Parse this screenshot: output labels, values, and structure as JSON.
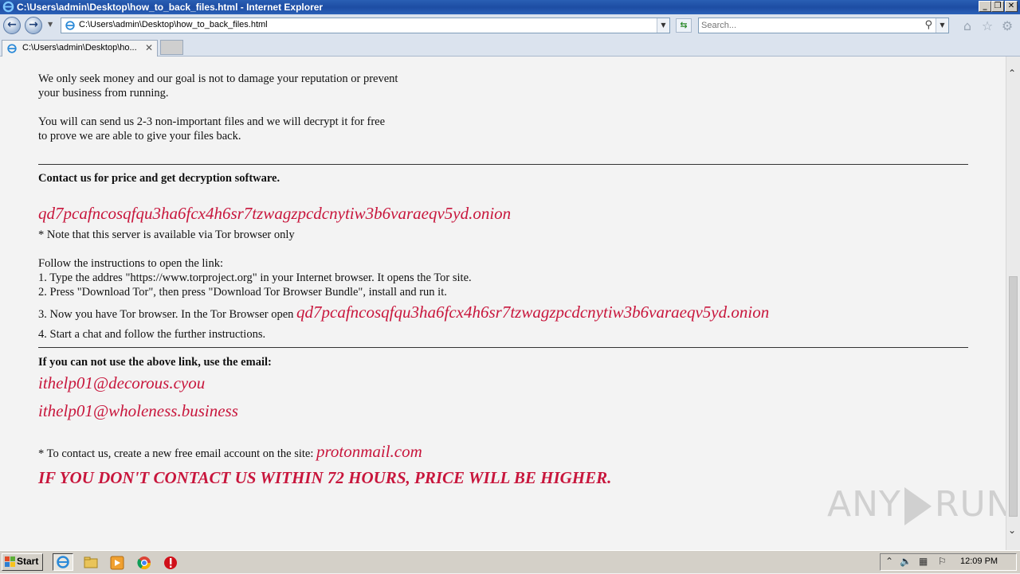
{
  "window": {
    "title": "C:\\Users\\admin\\Desktop\\how_to_back_files.html - Internet Explorer",
    "minimize_label": "_",
    "restore_label": "❐",
    "close_label": "✕"
  },
  "navbar": {
    "back_label": "←",
    "forward_label": "→",
    "address": "C:\\Users\\admin\\Desktop\\how_to_back_files.html",
    "search_placeholder": "Search...",
    "refresh_label": "⇆"
  },
  "tab": {
    "label": "C:\\Users\\admin\\Desktop\\ho...",
    "close_label": "✕"
  },
  "content": {
    "para1_line1": "We only seek money and our goal is not to damage your reputation or prevent",
    "para1_line2": "your business from running.",
    "para2_line1": "You will can send us 2-3 non-important files and we will decrypt it for free",
    "para2_line2": "to prove we are able to give your files back.",
    "contact_heading": "Contact us for price and get decryption software.",
    "onion_link": "qd7pcafncosqfqu3ha6fcx4h6sr7tzwagzpcdcnytiw3b6varaeqv5yd.onion",
    "tor_note": "* Note that this server is available via Tor browser only",
    "instructions_intro": "Follow the instructions to open the link:",
    "step1": "1. Type the addres \"https://www.torproject.org\" in your Internet browser. It opens the Tor site.",
    "step2": "2. Press \"Download Tor\", then press \"Download Tor Browser Bundle\", install and run it.",
    "step3_prefix": "3. Now you have Tor browser. In the Tor Browser open",
    "step3_link": "qd7pcafncosqfqu3ha6fcx4h6sr7tzwagzpcdcnytiw3b6varaeqv5yd.onion",
    "step4": "4. Start a chat and follow the further instructions.",
    "email_heading": "If you can not use the above link, use the email:",
    "email1": "ithelp01@decorous.cyou",
    "email2": "ithelp01@wholeness.business",
    "proton_prefix": "* To contact us, create a new free email account on the site:",
    "proton_link": "protonmail.com",
    "warning": "IF YOU DON'T CONTACT US WITHIN 72 HOURS, PRICE WILL BE HIGHER."
  },
  "watermark": {
    "left": "ANY",
    "right": "RUN"
  },
  "taskbar": {
    "start_label": "Start",
    "time": "12:09 PM"
  },
  "icons": {
    "home": "home-icon",
    "favorites": "star-icon",
    "tools": "gear-icon"
  },
  "colors": {
    "link_red": "#c8163c",
    "titlebar_blue": "#1d4da3"
  }
}
